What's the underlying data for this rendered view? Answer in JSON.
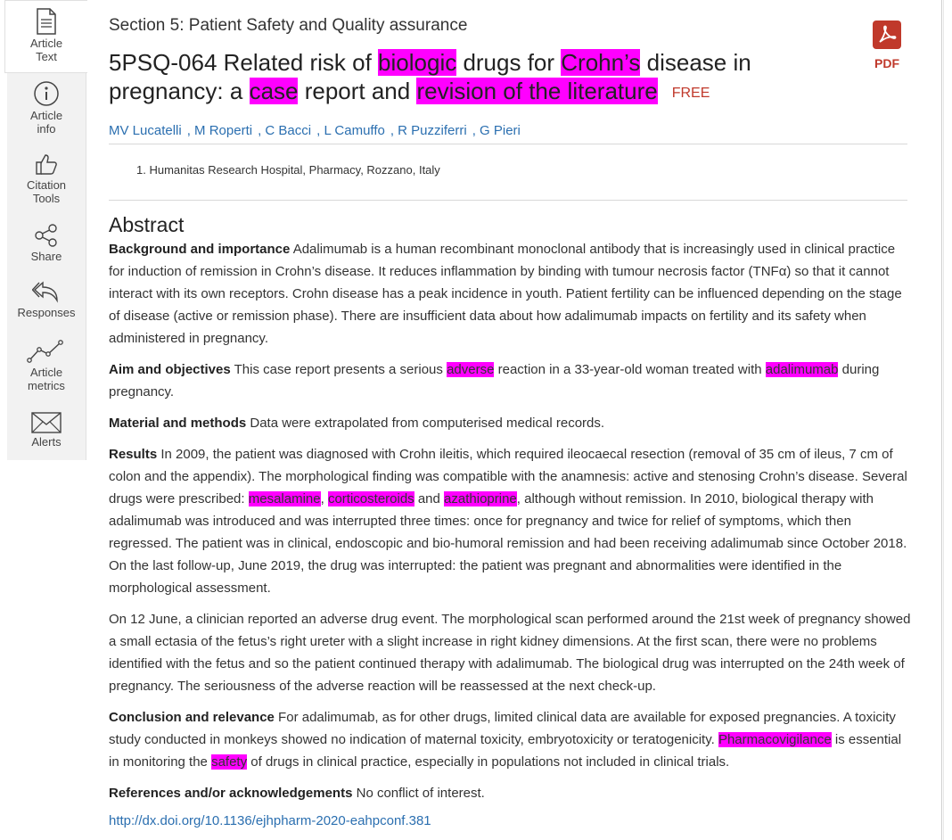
{
  "sidebar": {
    "items": [
      {
        "label": "Article\nText",
        "icon": "document-icon"
      },
      {
        "label": "Article\ninfo",
        "icon": "info-icon"
      },
      {
        "label": "Citation\nTools",
        "icon": "thumbs-up-icon"
      },
      {
        "label": "Share",
        "icon": "share-icon"
      },
      {
        "label": "Responses",
        "icon": "reply-icon"
      },
      {
        "label": "Article\nmetrics",
        "icon": "metrics-icon"
      },
      {
        "label": "Alerts",
        "icon": "envelope-icon"
      }
    ]
  },
  "article": {
    "section": "Section 5: Patient Safety and Quality assurance",
    "title_parts": {
      "t1": "5PSQ-064 Related risk of ",
      "h1": "biologic",
      "t2": " drugs for ",
      "h2": "Crohn’s",
      "t3": " disease in pregnancy: a ",
      "h3": "case",
      "t4": " report and ",
      "h4": "revision of the literature"
    },
    "free_label": "FREE",
    "pdf_label": "PDF",
    "authors": [
      "MV Lucatelli",
      "M Roperti",
      "C Bacci",
      "L Camuffo",
      "R Puzziferri",
      "G Pieri"
    ],
    "affiliation": "1. Humanitas Research Hospital, Pharmacy, Rozzano, Italy",
    "abstract_heading": "Abstract",
    "p1": {
      "head": "Background and importance",
      "text": " Adalimumab is a human recombinant monoclonal antibody that is increasingly used in clinical practice for induction of remission in Crohn’s disease. It reduces inflammation by binding with tumour necrosis factor (TNFα) so that it cannot interact with its own receptors. Crohn disease has a peak incidence in youth. Patient fertility can be influenced depending on the stage of disease (active or remission phase). There are insufficient data about how adalimumab impacts on fertility and its safety when administered in pregnancy."
    },
    "p2": {
      "head": "Aim and objectives",
      "t1": " This case report presents a serious ",
      "h1": "adverse",
      "t2": " reaction in a 33-year-old woman treated with ",
      "h2": "adalimumab",
      "t3": " during pregnancy."
    },
    "p3": {
      "head": "Material and methods",
      "text": " Data were extrapolated from computerised medical records."
    },
    "p4": {
      "head": "Results",
      "t1": " In 2009, the patient was diagnosed with Crohn ileitis, which required ileocaecal resection (removal of 35 cm of ileus, 7 cm of colon and the appendix). The morphological finding was compatible with the anamnesis: active and stenosing Crohn’s disease. Several drugs were prescribed: ",
      "h1": "mesalamine",
      "t2": ", ",
      "h2": "corticosteroids",
      "t3": " and ",
      "h3": "azathioprine",
      "t4": ", although without remission. In 2010, biological therapy with adalimumab was introduced and was interrupted three times: once for pregnancy and twice for relief of symptoms, which then regressed. The patient was in clinical, endoscopic and bio-humoral remission and had been receiving adalimumab since October 2018. On the last follow-up, June 2019, the drug was interrupted: the patient was pregnant and abnormalities were identified in the morphological assessment."
    },
    "p5": {
      "text": "On 12 June, a clinician reported an adverse drug event. The morphological scan performed around the 21st week of pregnancy showed a small ectasia of the fetus’s right ureter with a slight increase in right kidney dimensions. At the first scan, there were no problems identified with the fetus and so the patient continued therapy with adalimumab. The biological drug was interrupted on the 24th week of pregnancy. The seriousness of the adverse reaction will be reassessed at the next check-up."
    },
    "p6": {
      "head": "Conclusion and relevance",
      "t1": " For adalimumab, as for other drugs, limited clinical data are available for exposed pregnancies. A toxicity study conducted in monkeys showed no indication of maternal toxicity, embryotoxicity or teratogenicity. ",
      "h1": "Pharmacovigilance",
      "t2": " is essential in monitoring the ",
      "h2": "safety",
      "t3": " of drugs in clinical practice, especially in populations not included in clinical trials."
    },
    "p7": {
      "head": "References and/or acknowledgements",
      "text": " No conflict of interest."
    },
    "doi": "http://dx.doi.org/10.1136/ejhpharm-2020-eahpconf.381"
  },
  "colors": {
    "highlight": "#ff00ff",
    "link": "#2b6fb0",
    "pdf": "#c0392b"
  }
}
